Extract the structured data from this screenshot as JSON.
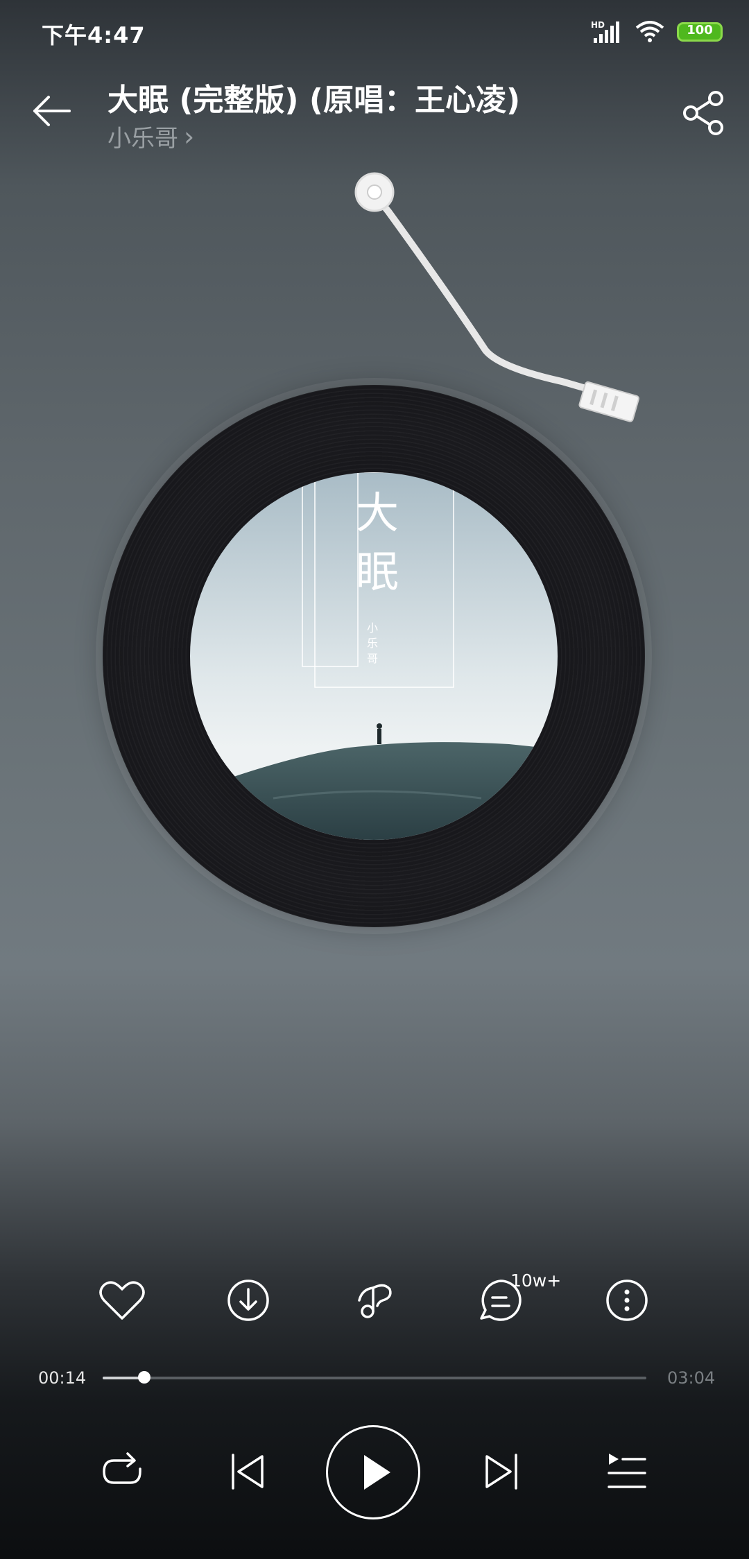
{
  "status_bar": {
    "time": "下午4:47",
    "network_label": "HD",
    "battery": "100"
  },
  "header": {
    "title": "大眠 (完整版) (原唱：王心凌)",
    "artist": "小乐哥",
    "artist_chevron": "›"
  },
  "cover_art": {
    "title": "大眠",
    "artist": "小乐哥"
  },
  "actions": {
    "like": "heart-icon",
    "download": "download-icon",
    "effect": "music-note-icon",
    "comments": "comment-icon",
    "comment_count": "10w+",
    "more": "more-icon"
  },
  "progress": {
    "current": "00:14",
    "total": "03:04",
    "fraction": 0.076
  },
  "controls": {
    "repeat": "repeat-icon",
    "previous": "previous-icon",
    "play": "play-icon",
    "next": "next-icon",
    "playlist": "playlist-icon"
  },
  "colors": {
    "battery": "#4fb81e",
    "accent": "#ffffff"
  }
}
